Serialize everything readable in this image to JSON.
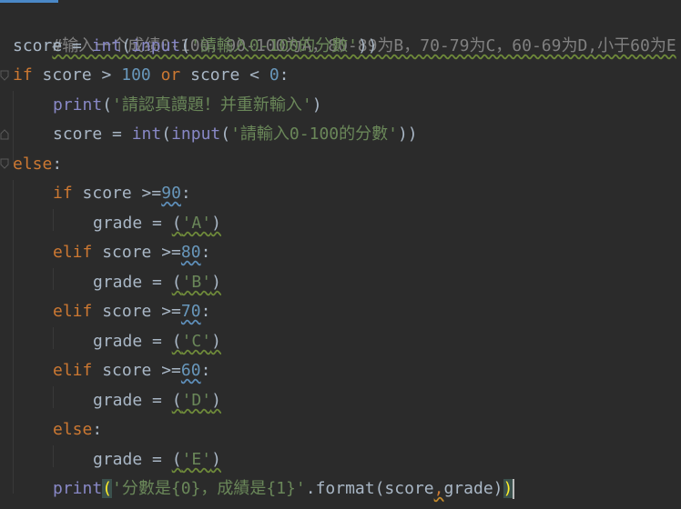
{
  "colors": {
    "background": "#2b2b2b",
    "keyword": "#cc7832",
    "number": "#6897bb",
    "string": "#6a8759",
    "builtin": "#8888c6",
    "comment": "#808080",
    "text": "#a9b7c6"
  },
  "code": {
    "l1": {
      "comment": "#输入一个成绩0-100，90-100为A，80-89为B，70-79为C，60-69为D,小于60为E"
    },
    "l2": {
      "name": "score",
      "eq": " = ",
      "int": "int",
      "p1": "(",
      "input": "input",
      "p2": "(",
      "str": "'請輸入0-100的分數'",
      "close": "))"
    },
    "l3": {
      "if": "if",
      "a": " score > ",
      "n1": "100",
      "or": "or",
      "b": " score < ",
      "n2": "0",
      "colon": ":"
    },
    "l4": {
      "print": "print",
      "open": "(",
      "str": "'請認真讀題！并重新輸入'",
      "close": ")"
    },
    "l5": {
      "name": "score",
      "eq": " = ",
      "int": "int",
      "p1": "(",
      "input": "input",
      "p2": "(",
      "str": "'請輸入0-100的分數'",
      "close": "))"
    },
    "l6": {
      "else": "else",
      "colon": ":"
    },
    "l7": {
      "if": "if",
      "a": " score >=",
      "n": "90",
      "colon": ":"
    },
    "l8": {
      "a": "grade = ",
      "p1": "(",
      "str": "'A'",
      "p2": ")"
    },
    "l9": {
      "elif": "elif",
      "a": " score >=",
      "n": "80",
      "colon": ":"
    },
    "l10": {
      "a": "grade = ",
      "p1": "(",
      "str": "'B'",
      "p2": ")"
    },
    "l11": {
      "elif": "elif",
      "a": " score >=",
      "n": "70",
      "colon": ":"
    },
    "l12": {
      "a": "grade = ",
      "p1": "(",
      "str": "'C'",
      "p2": ")"
    },
    "l13": {
      "elif": "elif",
      "a": " score >=",
      "n": "60",
      "colon": ":"
    },
    "l14": {
      "a": "grade = ",
      "p1": "(",
      "str": "'D'",
      "p2": ")"
    },
    "l15": {
      "else": "else",
      "colon": ":"
    },
    "l16": {
      "a": "grade = ",
      "p1": "(",
      "str": "'E'",
      "p2": ")"
    },
    "l17": {
      "print": "print",
      "open": "(",
      "str": "'分數是{0}，成績是{1}'",
      "fmt": ".format(score",
      "comma": ",",
      "b": "grade)",
      "close": ")"
    }
  }
}
